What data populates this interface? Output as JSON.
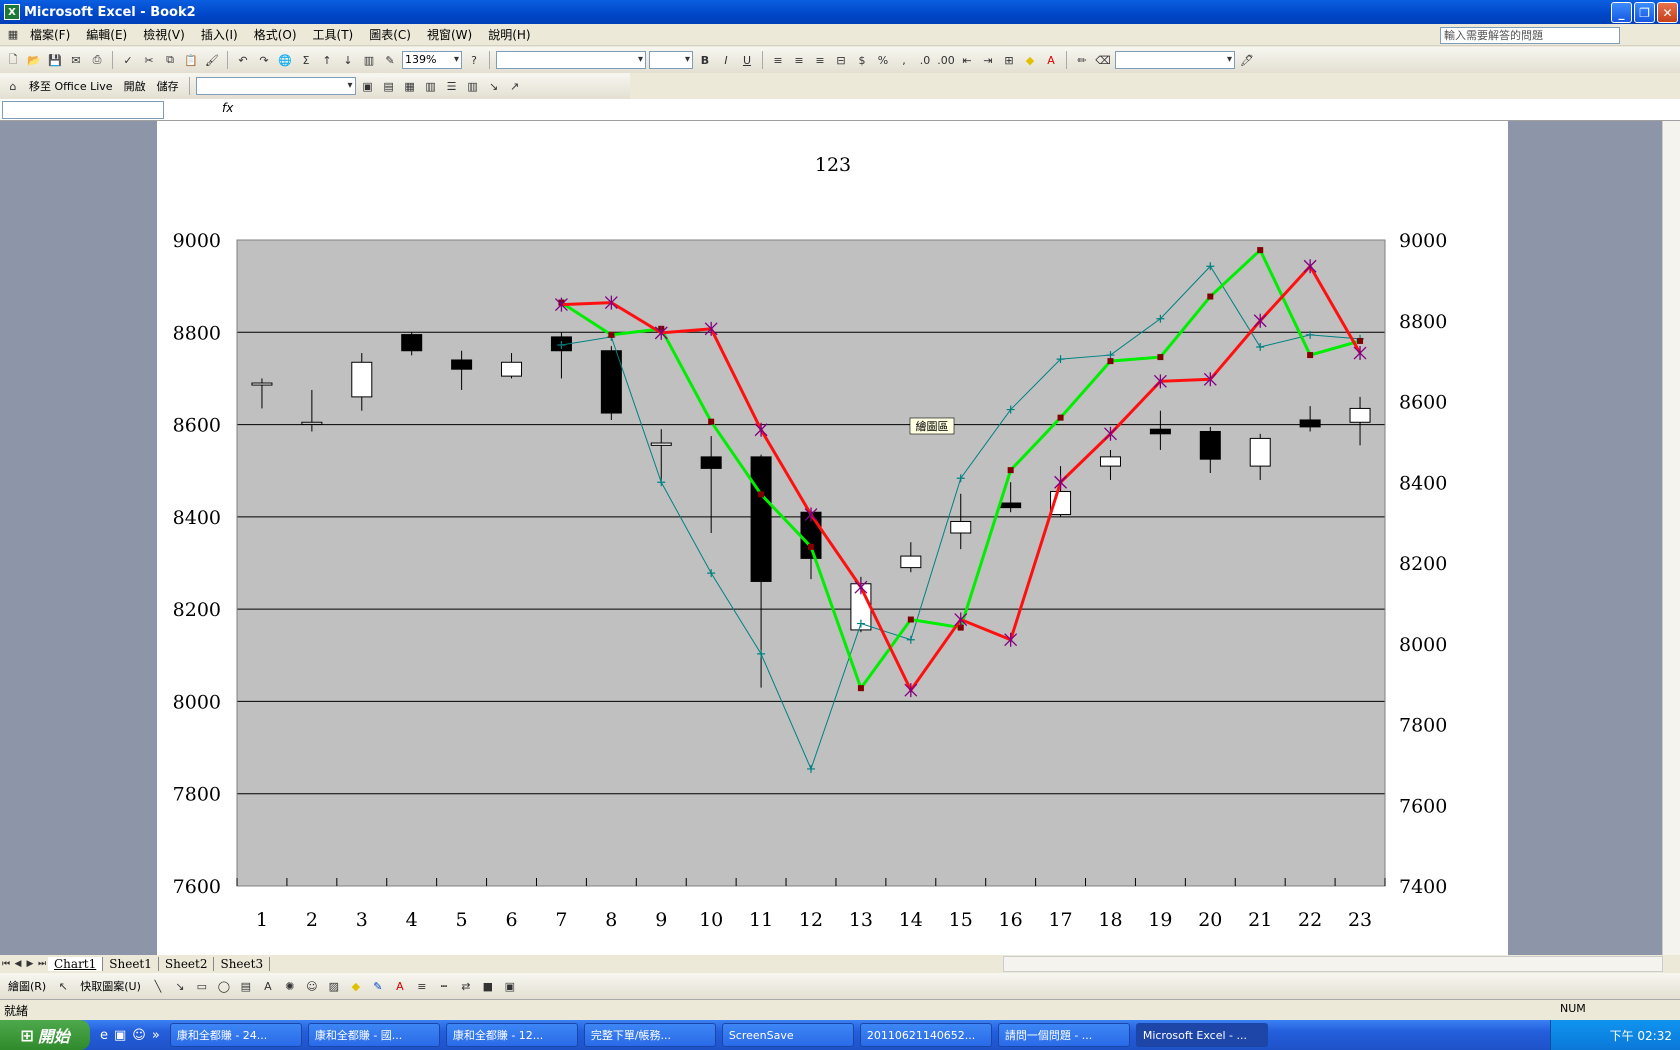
{
  "window": {
    "title": "Microsoft Excel - Book2",
    "app_icon": "X"
  },
  "menu": [
    "檔案(F)",
    "編輯(E)",
    "檢視(V)",
    "插入(I)",
    "格式(O)",
    "工具(T)",
    "圖表(C)",
    "視窗(W)",
    "說明(H)"
  ],
  "help_box": {
    "placeholder": "輸入需要解答的問題"
  },
  "toolbar1": {
    "zoom": "139%"
  },
  "toolbar2": {
    "office_live": "移至 Office Live",
    "open": "開啟",
    "save": "儲存"
  },
  "formula": {
    "fx": "fx"
  },
  "chart": {
    "title": "123",
    "tooltip": "繪圖區"
  },
  "chart_data": {
    "type": "candlestick+line",
    "title": "123",
    "categories": [
      "1",
      "2",
      "3",
      "4",
      "5",
      "6",
      "7",
      "8",
      "9",
      "10",
      "11",
      "12",
      "13",
      "14",
      "15",
      "16",
      "17",
      "18",
      "19",
      "20",
      "21",
      "22",
      "23"
    ],
    "y_left": {
      "min": 7600,
      "max": 9000,
      "ticks": [
        7600,
        7800,
        8000,
        8200,
        8400,
        8600,
        8800,
        9000
      ]
    },
    "y_right": {
      "min": 7400,
      "max": 9000,
      "ticks": [
        7400,
        7600,
        7800,
        8000,
        8200,
        8400,
        8600,
        8800,
        9000
      ]
    },
    "grid": true,
    "plot_bg": "#c0c0c0",
    "candles": [
      {
        "open": 8690,
        "close": 8690,
        "high": 8700,
        "low": 8635
      },
      {
        "open": 8605,
        "close": 8605,
        "high": 8675,
        "low": 8585
      },
      {
        "open": 8660,
        "close": 8735,
        "high": 8755,
        "low": 8630
      },
      {
        "open": 8795,
        "close": 8760,
        "high": 8800,
        "low": 8750
      },
      {
        "open": 8740,
        "close": 8720,
        "high": 8760,
        "low": 8675
      },
      {
        "open": 8705,
        "close": 8735,
        "high": 8755,
        "low": 8700
      },
      {
        "open": 8790,
        "close": 8760,
        "high": 8800,
        "low": 8700
      },
      {
        "open": 8760,
        "close": 8625,
        "high": 8770,
        "low": 8610
      },
      {
        "open": 8555,
        "close": 8560,
        "high": 8590,
        "low": 8480
      },
      {
        "open": 8530,
        "close": 8505,
        "high": 8575,
        "low": 8365
      },
      {
        "open": 8530,
        "close": 8260,
        "high": 8535,
        "low": 8030
      },
      {
        "open": 8410,
        "close": 8310,
        "high": 8420,
        "low": 8265
      },
      {
        "open": 8155,
        "close": 8255,
        "high": 8270,
        "low": 8150
      },
      {
        "open": 8290,
        "close": 8315,
        "high": 8345,
        "low": 8280
      },
      {
        "open": 8365,
        "close": 8390,
        "high": 8450,
        "low": 8330
      },
      {
        "open": 8430,
        "close": 8420,
        "high": 8475,
        "low": 8410
      },
      {
        "open": 8405,
        "close": 8455,
        "high": 8510,
        "low": 8400
      },
      {
        "open": 8510,
        "close": 8530,
        "high": 8545,
        "low": 8480
      },
      {
        "open": 8590,
        "close": 8580,
        "high": 8630,
        "low": 8545
      },
      {
        "open": 8585,
        "close": 8525,
        "high": 8595,
        "low": 8495
      },
      {
        "open": 8510,
        "close": 8570,
        "high": 8580,
        "low": 8480
      },
      {
        "open": 8610,
        "close": 8595,
        "high": 8640,
        "low": 8585
      },
      {
        "open": 8605,
        "close": 8635,
        "high": 8660,
        "low": 8555
      }
    ],
    "series": [
      {
        "color": "#008080",
        "axis": "right",
        "marker": "plus",
        "width": 1,
        "x": [
          7,
          8,
          9,
          10,
          11,
          12,
          13,
          14,
          15,
          16,
          17,
          18,
          19,
          20,
          21,
          22,
          23
        ],
        "values": [
          8740,
          8760,
          8400,
          8175,
          7975,
          7690,
          8050,
          8010,
          8410,
          8580,
          8705,
          8715,
          8805,
          8935,
          8735,
          8765,
          8755
        ]
      },
      {
        "color": "#00ee00",
        "axis": "right",
        "marker": "square",
        "width": 3,
        "x": [
          7,
          8,
          9,
          10,
          11,
          12,
          13,
          14,
          15,
          16,
          17,
          18,
          19,
          20,
          21,
          22,
          23
        ],
        "values": [
          8845,
          8765,
          8780,
          8550,
          8370,
          8240,
          7890,
          8060,
          8040,
          8430,
          8560,
          8700,
          8710,
          8860,
          8975,
          8715,
          8750
        ]
      },
      {
        "color": "#ff1010",
        "axis": "right",
        "marker": "x",
        "width": 3,
        "x": [
          7,
          8,
          9,
          10,
          11,
          12,
          13,
          14,
          15,
          16,
          17,
          18,
          19,
          20,
          21,
          22,
          23
        ],
        "values": [
          8840,
          8845,
          8770,
          8780,
          8530,
          8320,
          8140,
          7885,
          8060,
          8010,
          8400,
          8520,
          8650,
          8655,
          8800,
          8935,
          8720
        ]
      }
    ]
  },
  "sheet_tabs": [
    "Chart1",
    "Sheet1",
    "Sheet2",
    "Sheet3"
  ],
  "drawing_bar": {
    "draw": "繪圖(R)",
    "autoshapes": "快取圖案(U)"
  },
  "status": {
    "left": "就緒",
    "num": "NUM"
  },
  "taskbar": {
    "start": "開始",
    "tasks": [
      "康和全都賺 - 24...",
      "康和全都賺 - 國...",
      "康和全都賺 - 12...",
      "完整下單/帳務...",
      "ScreenSave",
      "20110621140652...",
      "請問一個問題 - ...",
      "Microsoft Excel - ..."
    ],
    "clock": "下午 02:32"
  }
}
